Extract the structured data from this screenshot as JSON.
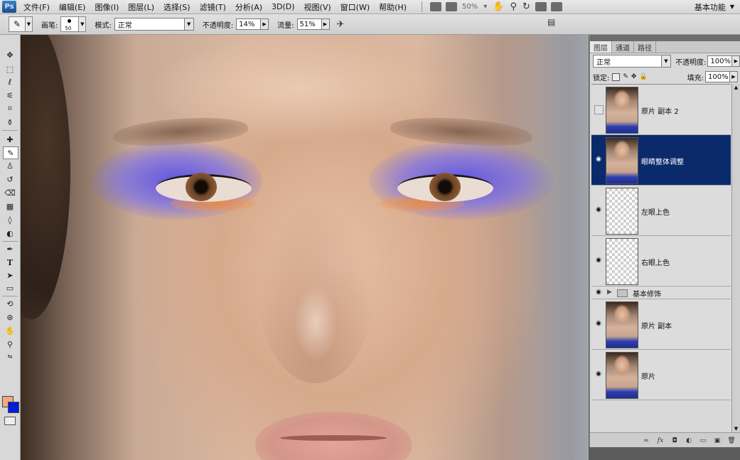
{
  "app": {
    "logo": "Ps"
  },
  "menu": {
    "items": [
      "文件(F)",
      "编辑(E)",
      "图像(I)",
      "图层(L)",
      "选择(S)",
      "滤镜(T)",
      "分析(A)",
      "3D(D)",
      "视图(V)",
      "窗口(W)",
      "帮助(H)"
    ],
    "zoom": "50%",
    "workspace": "基本功能"
  },
  "options": {
    "brush_label": "画笔:",
    "brush_size": "50",
    "mode_label": "模式:",
    "mode_value": "正常",
    "opacity_label": "不透明度:",
    "opacity_value": "14%",
    "flow_label": "流量:",
    "flow_value": "51%"
  },
  "tools": {
    "foreground_color": "#f3a883",
    "background_color": "#001ed8"
  },
  "layers_panel": {
    "tabs": [
      "图层",
      "通道",
      "路径"
    ],
    "blend_mode": "正常",
    "opacity_label": "不透明度:",
    "opacity_value": "100%",
    "lock_label": "锁定:",
    "fill_label": "填充:",
    "fill_value": "100%",
    "layers": [
      {
        "name": "原片 副本 2",
        "visible": false,
        "selected": false,
        "thumb": "photo"
      },
      {
        "name": "眼睛整体调整",
        "visible": true,
        "selected": true,
        "thumb": "photo"
      },
      {
        "name": "左眼上色",
        "visible": true,
        "selected": false,
        "thumb": "transparent"
      },
      {
        "name": "右眼上色",
        "visible": true,
        "selected": false,
        "thumb": "transparent"
      },
      {
        "name": "基本修饰",
        "visible": true,
        "selected": false,
        "thumb": "group"
      },
      {
        "name": "原片 副本",
        "visible": true,
        "selected": false,
        "thumb": "photo"
      },
      {
        "name": "原片",
        "visible": true,
        "selected": false,
        "thumb": "photo"
      }
    ]
  }
}
